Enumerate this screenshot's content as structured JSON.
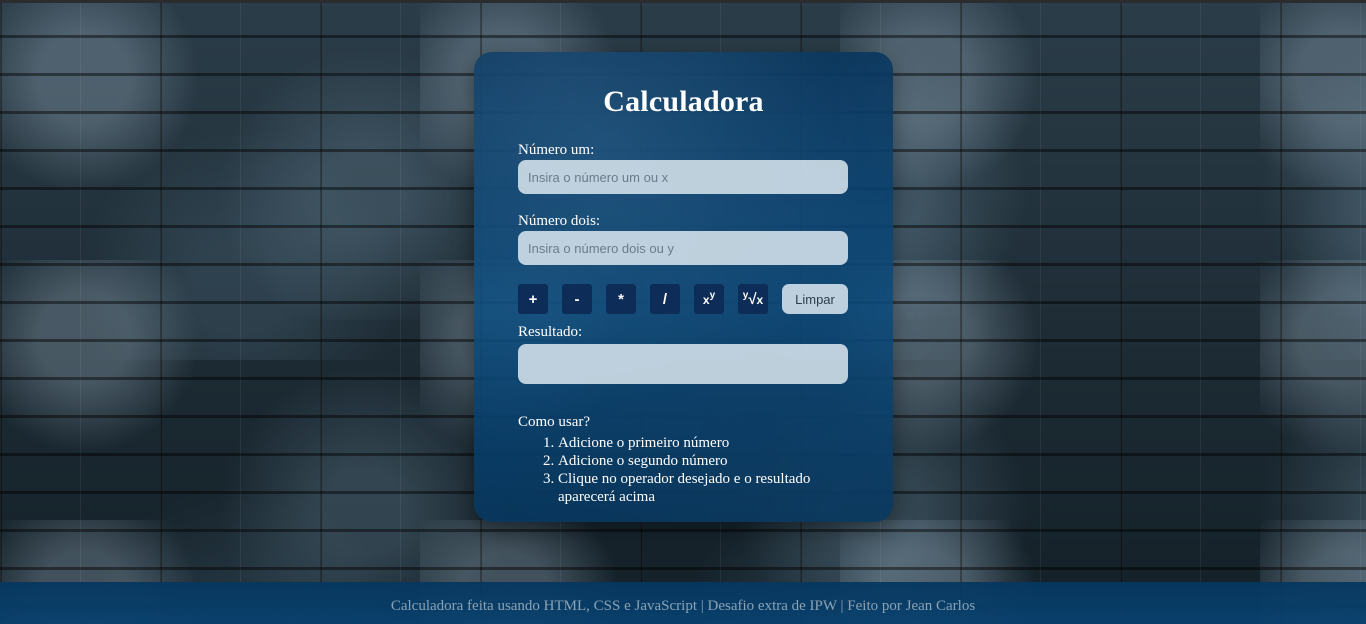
{
  "app": {
    "title": "Calculadora"
  },
  "form": {
    "number_one_label": "Número um:",
    "number_one_placeholder": "Insira o número um ou x",
    "number_one_value": "",
    "number_two_label": "Número dois:",
    "number_two_placeholder": "Insira o número dois ou y",
    "number_two_value": "",
    "result_label": "Resultado:",
    "result_value": ""
  },
  "operators": {
    "add": "+",
    "subtract": "-",
    "multiply": "*",
    "divide": "/",
    "power_base": "x",
    "power_exp": "y",
    "root_index": "y",
    "root_symbol": "√",
    "root_base": "x",
    "clear": "Limpar"
  },
  "instructions": {
    "title": "Como usar?",
    "steps": [
      "Adicione o primeiro número",
      "Adicione o segundo número",
      "Clique no operador desejado e o resultado aparecerá acima"
    ]
  },
  "footer": {
    "text": "Calculadora feita usando HTML, CSS e JavaScript | Desafio extra de IPW | Feito por Jean Carlos"
  },
  "colors": {
    "panel": "#0b4a7d",
    "operator_button": "#0d2c57",
    "input_background": "#d2dfe9",
    "footer_text": "#8aa2b5"
  }
}
